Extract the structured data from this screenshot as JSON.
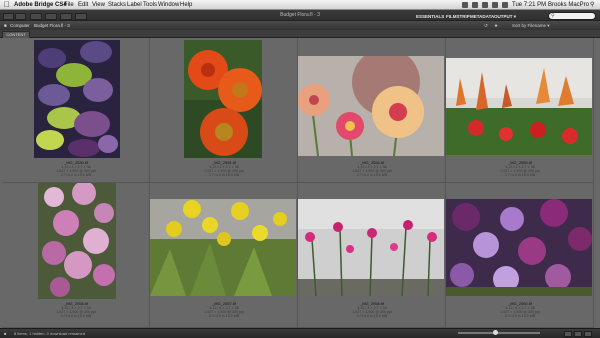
{
  "menubar": {
    "items": [
      "Adobe Bridge CS4",
      "File",
      "Edit",
      "View",
      "Stacks",
      "Label",
      "Tools",
      "Window",
      "Help"
    ],
    "clock": "Tue 7:21 PM",
    "user": "Brooks MacPro"
  },
  "window": {
    "title": "Budget Flora.fl - 3"
  },
  "toolbar": {
    "workspaces": [
      "ESSENTIALS",
      "FILMSTRIP",
      "METADATA",
      "OUTPUT ▾"
    ]
  },
  "pathbar": {
    "crumbs": [
      "Computer",
      "Budget Flora.fl - 3"
    ],
    "sort_label": "Sort by Filename ▾"
  },
  "tabs": [
    "CONTENT"
  ],
  "thumbnails": [
    {
      "filename": "_MG_2530.tif",
      "line1": "4,12 / 4 × 2,7 × 38",
      "line2": "1,027 × 1,500 @ 300 ppi",
      "line3": "2.7×4.0 in 15.0 MB"
    },
    {
      "filename": "_MG_2551.tif",
      "line1": "4,12 / 4 × 2,7 × 38",
      "line2": "1,027 × 1,500 @ 300 ppi",
      "line3": "2.7×4.0 in 15.0 MB"
    },
    {
      "filename": "_MG_2554.tif",
      "line1": "4,12 / 4 × 2,7 × 38",
      "line2": "1,027 × 1,500 @ 300 ppi",
      "line3": "2.7×4.0 in 15.0 MB"
    },
    {
      "filename": "_MG_2555.tif",
      "line1": "4,12 / 4 × 2,7 × 38",
      "line2": "1,027 × 1,500 @ 300 ppi",
      "line3": "2.7×4.0 in 15.0 MB"
    },
    {
      "filename": "_MG_2556.tif",
      "line1": "4,12 / 4 × 2,7 × 38",
      "line2": "1,027 × 1,500 @ 300 ppi",
      "line3": "2.7×4.0 in 15.0 MB"
    },
    {
      "filename": "_MG_2557.tif",
      "line1": "4,12 / 4 × 2,7 × 38",
      "line2": "1,027 × 1,500 @ 300 ppi",
      "line3": "2.7×4.0 in 15.0 MB"
    },
    {
      "filename": "_MG_2558.tif",
      "line1": "4,12 / 4 × 2,7 × 38",
      "line2": "1,027 × 1,500 @ 300 ppi",
      "line3": "2.7×4.0 in 15.0 MB"
    },
    {
      "filename": "_MG_2560.tif",
      "line1": "4,12 / 4 × 2,7 × 38",
      "line2": "1,027 × 1,500 @ 300 ppi",
      "line3": "2.7×4.0 in 15.0 MB"
    }
  ],
  "statusbar": {
    "text": "8 items, 1 hidden, 0 download remained"
  },
  "thumbnail_size": 0.46,
  "icons": [
    "apple-icon",
    "search-icon",
    "back-icon",
    "forward-icon",
    "folder-icon",
    "grid-view-icon",
    "list-view-icon",
    "detail-view-icon"
  ]
}
